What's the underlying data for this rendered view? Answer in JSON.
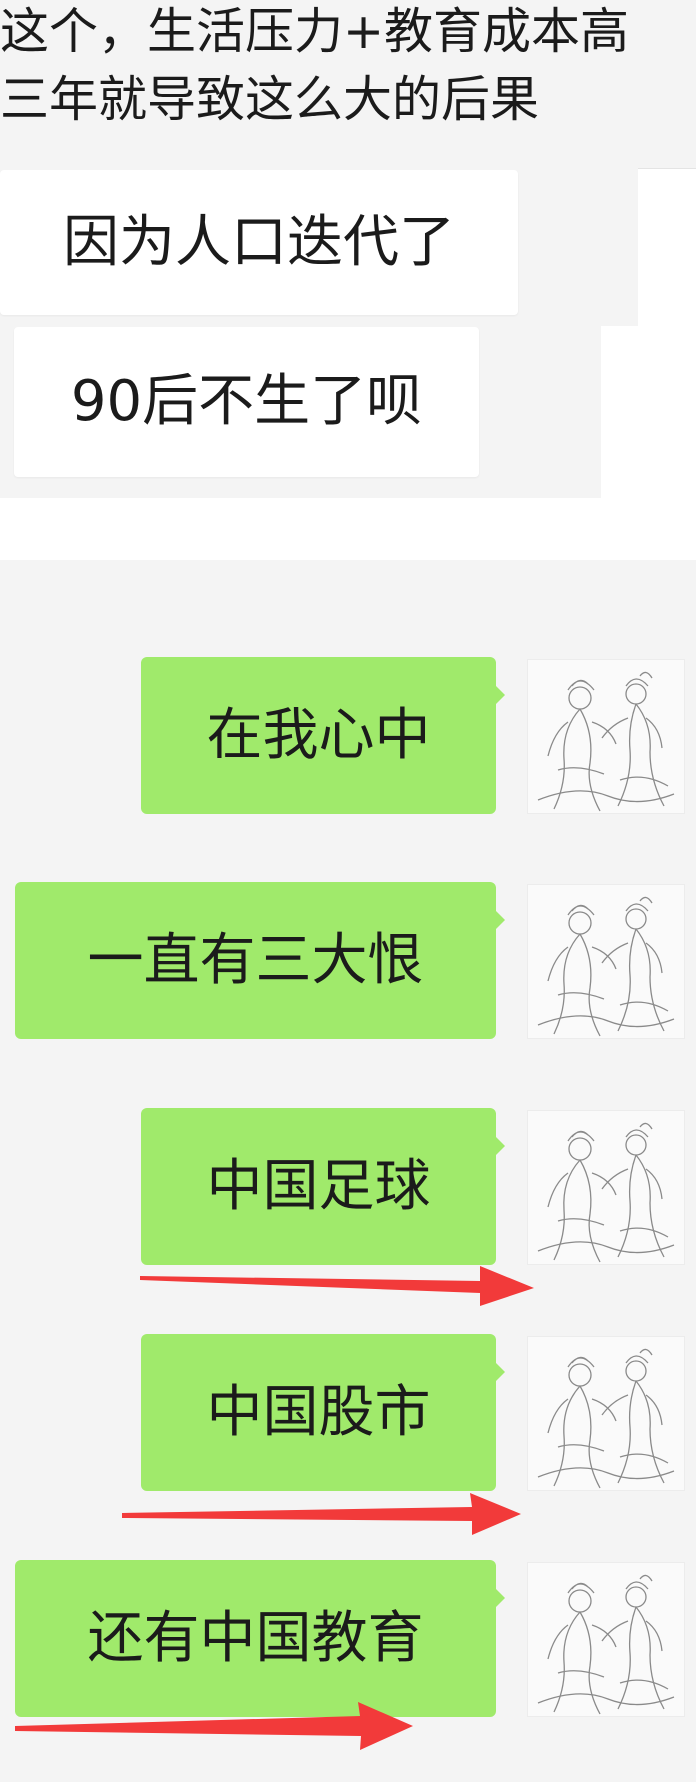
{
  "top_text": {
    "line1": "这个，生活压力+教育成本高",
    "line2": "三年就导致这么大的后果"
  },
  "received_messages": [
    {
      "text": "因为人口迭代了"
    },
    {
      "text": "90后不生了呗"
    }
  ],
  "sent_messages": [
    {
      "text": "在我心中"
    },
    {
      "text": "一直有三大恨"
    },
    {
      "text": "中国足球"
    },
    {
      "text": "中国股市"
    },
    {
      "text": "还有中国教育"
    }
  ],
  "colors": {
    "sent_bubble": "#a0ea6b",
    "received_bubble": "#ffffff",
    "chat_background": "#f4f4f4",
    "annotation_arrow": "#f23a3a"
  },
  "icons": {
    "avatar": "sketch-figures-avatar-icon",
    "annotation": "red-arrow-icon"
  }
}
